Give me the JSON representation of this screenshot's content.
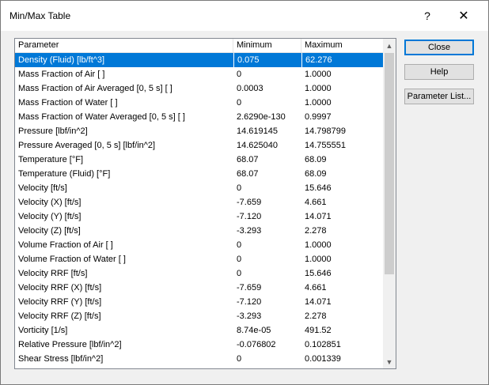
{
  "window": {
    "title": "Min/Max Table",
    "help_glyph": "?",
    "close_glyph": "✕"
  },
  "table": {
    "columns": [
      "Parameter",
      "Minimum",
      "Maximum"
    ],
    "selected_index": 0,
    "rows": [
      [
        "Density (Fluid) [lb/ft^3]",
        "0.075",
        "62.276"
      ],
      [
        "Mass Fraction of Air [ ]",
        "0",
        "1.0000"
      ],
      [
        "Mass Fraction of Air Averaged [0, 5 s] [ ]",
        "0.0003",
        "1.0000"
      ],
      [
        "Mass Fraction of Water [ ]",
        "0",
        "1.0000"
      ],
      [
        "Mass Fraction of Water Averaged [0, 5 s] [ ]",
        "2.6290e-130",
        "0.9997"
      ],
      [
        "Pressure [lbf/in^2]",
        "14.619145",
        "14.798799"
      ],
      [
        "Pressure Averaged [0, 5 s] [lbf/in^2]",
        "14.625040",
        "14.755551"
      ],
      [
        "Temperature [°F]",
        "68.07",
        "68.09"
      ],
      [
        "Temperature (Fluid) [°F]",
        "68.07",
        "68.09"
      ],
      [
        "Velocity [ft/s]",
        "0",
        "15.646"
      ],
      [
        "Velocity (X) [ft/s]",
        "-7.659",
        "4.661"
      ],
      [
        "Velocity (Y) [ft/s]",
        "-7.120",
        "14.071"
      ],
      [
        "Velocity (Z) [ft/s]",
        "-3.293",
        "2.278"
      ],
      [
        "Volume Fraction of Air [ ]",
        "0",
        "1.0000"
      ],
      [
        "Volume Fraction of Water [ ]",
        "0",
        "1.0000"
      ],
      [
        "Velocity RRF [ft/s]",
        "0",
        "15.646"
      ],
      [
        "Velocity RRF (X) [ft/s]",
        "-7.659",
        "4.661"
      ],
      [
        "Velocity RRF (Y) [ft/s]",
        "-7.120",
        "14.071"
      ],
      [
        "Velocity RRF (Z) [ft/s]",
        "-3.293",
        "2.278"
      ],
      [
        "Vorticity [1/s]",
        "8.74e-05",
        "491.52"
      ],
      [
        "Relative Pressure [lbf/in^2]",
        "-0.076802",
        "0.102851"
      ],
      [
        "Shear Stress [lbf/in^2]",
        "0",
        "0.001339"
      ]
    ]
  },
  "scrollbar": {
    "up_glyph": "▲",
    "down_glyph": "▼"
  },
  "buttons": {
    "close": "Close",
    "help": "Help",
    "parameter_list": "Parameter List..."
  },
  "colors": {
    "selection": "#0078d7",
    "default_button_border": "#0078d7"
  },
  "icons": {
    "help": "question-mark-icon",
    "close": "close-icon",
    "scroll_up": "scroll-up-arrow-icon",
    "scroll_down": "scroll-down-arrow-icon"
  }
}
